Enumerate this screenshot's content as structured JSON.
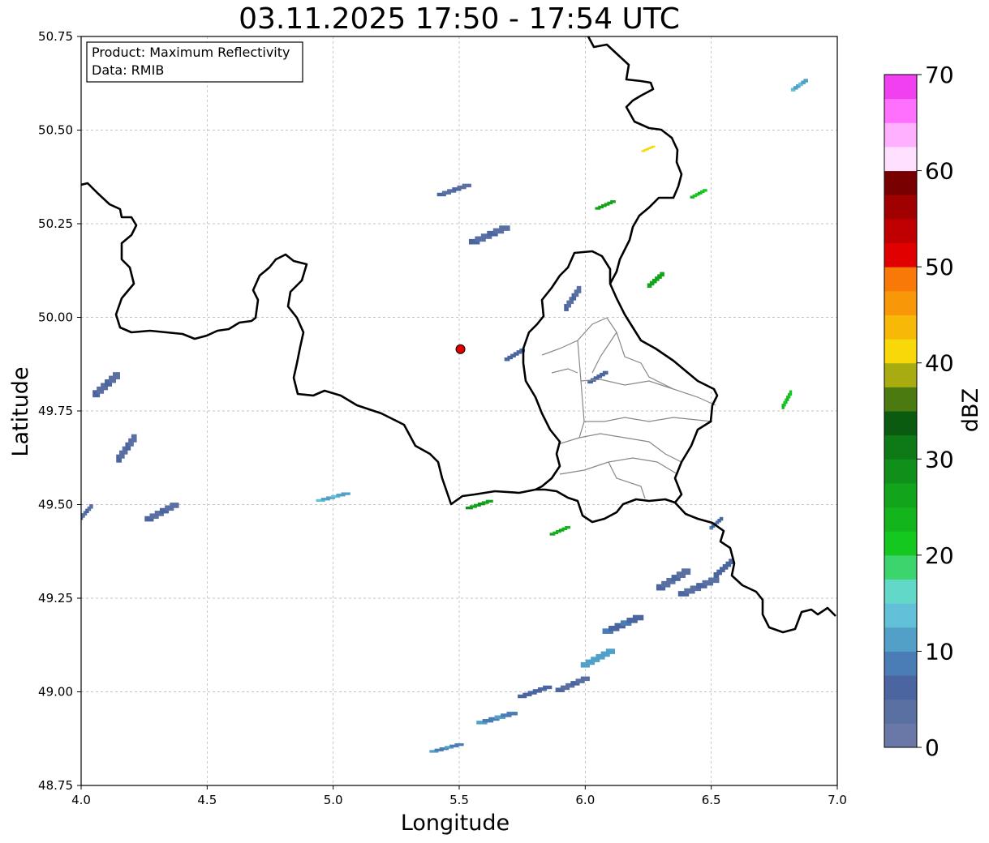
{
  "title": "03.11.2025 17:50 - 17:54 UTC",
  "axes": {
    "xlabel": "Longitude",
    "ylabel": "Latitude",
    "x_range": [
      4.0,
      7.0
    ],
    "y_range": [
      48.75,
      50.75
    ],
    "x_ticks": [
      "4.0",
      "4.5",
      "5.0",
      "5.5",
      "6.0",
      "6.5",
      "7.0"
    ],
    "y_ticks": [
      "48.75",
      "49.00",
      "49.25",
      "49.50",
      "49.75",
      "50.00",
      "50.25",
      "50.50",
      "50.75"
    ],
    "grid": true
  },
  "info_box": {
    "line1": "Product: Maximum Reflectivity",
    "line2": "Data: RMIB"
  },
  "colorbar": {
    "label": "dBZ",
    "min": 0,
    "max": 70,
    "ticks": [
      "0",
      "10",
      "20",
      "30",
      "40",
      "50",
      "60",
      "70"
    ],
    "colors": [
      "#6a78a8",
      "#5a6fa2",
      "#4a65a0",
      "#4a7db5",
      "#52a0c8",
      "#62c0d8",
      "#62d8c8",
      "#3cd46c",
      "#14c820",
      "#14b41c",
      "#12a41a",
      "#10901a",
      "#0e7a16",
      "#0a5a10",
      "#4a7a10",
      "#a8ac10",
      "#f8d808",
      "#f8b808",
      "#f89808",
      "#f87808",
      "#e00000",
      "#c00000",
      "#a00000",
      "#780000",
      "#ffe0ff",
      "#ffb0ff",
      "#ff70ff",
      "#f040f0"
    ]
  },
  "radar_site": {
    "lon": 5.505,
    "lat": 49.915,
    "color": "#e00000"
  },
  "chart_data": {
    "type": "map",
    "product": "Maximum Reflectivity",
    "source": "RMIB",
    "time_start": "03.11.2025 17:50",
    "time_end": "17:54 UTC",
    "extent": {
      "lon": [
        4.0,
        7.0
      ],
      "lat": [
        48.75,
        50.75
      ]
    },
    "echoes": [
      {
        "lon": 6.35,
        "lat": 49.3,
        "w": 0.1,
        "h": 0.07,
        "dbz": 3
      },
      {
        "lon": 6.45,
        "lat": 49.28,
        "w": 0.12,
        "h": 0.06,
        "dbz": 4
      },
      {
        "lon": 6.55,
        "lat": 49.33,
        "w": 0.06,
        "h": 0.06,
        "dbz": 5
      },
      {
        "lon": 6.15,
        "lat": 49.18,
        "w": 0.12,
        "h": 0.06,
        "dbz": 6
      },
      {
        "lon": 6.05,
        "lat": 49.09,
        "w": 0.1,
        "h": 0.06,
        "dbz": 10
      },
      {
        "lon": 5.95,
        "lat": 49.02,
        "w": 0.1,
        "h": 0.05,
        "dbz": 4
      },
      {
        "lon": 5.8,
        "lat": 49.0,
        "w": 0.1,
        "h": 0.04,
        "dbz": 5
      },
      {
        "lon": 5.65,
        "lat": 48.93,
        "w": 0.12,
        "h": 0.04,
        "dbz": 9
      },
      {
        "lon": 5.45,
        "lat": 48.85,
        "w": 0.1,
        "h": 0.03,
        "dbz": 8
      },
      {
        "lon": 4.1,
        "lat": 49.82,
        "w": 0.08,
        "h": 0.08,
        "dbz": 3
      },
      {
        "lon": 4.18,
        "lat": 49.65,
        "w": 0.06,
        "h": 0.09,
        "dbz": 3
      },
      {
        "lon": 4.32,
        "lat": 49.48,
        "w": 0.1,
        "h": 0.06,
        "dbz": 3
      },
      {
        "lon": 4.02,
        "lat": 49.48,
        "w": 0.04,
        "h": 0.05,
        "dbz": 3
      },
      {
        "lon": 5.62,
        "lat": 50.22,
        "w": 0.12,
        "h": 0.06,
        "dbz": 4
      },
      {
        "lon": 5.72,
        "lat": 49.9,
        "w": 0.06,
        "h": 0.04,
        "dbz": 5
      },
      {
        "lon": 5.95,
        "lat": 50.05,
        "w": 0.05,
        "h": 0.08,
        "dbz": 3
      },
      {
        "lon": 6.08,
        "lat": 50.3,
        "w": 0.06,
        "h": 0.03,
        "dbz": 25
      },
      {
        "lon": 6.45,
        "lat": 50.33,
        "w": 0.05,
        "h": 0.03,
        "dbz": 22
      },
      {
        "lon": 6.28,
        "lat": 50.1,
        "w": 0.05,
        "h": 0.05,
        "dbz": 25
      },
      {
        "lon": 6.25,
        "lat": 50.45,
        "w": 0.04,
        "h": 0.02,
        "dbz": 40
      },
      {
        "lon": 5.48,
        "lat": 50.34,
        "w": 0.1,
        "h": 0.04,
        "dbz": 4
      },
      {
        "lon": 5.0,
        "lat": 49.52,
        "w": 0.1,
        "h": 0.03,
        "dbz": 12
      },
      {
        "lon": 5.58,
        "lat": 49.5,
        "w": 0.08,
        "h": 0.03,
        "dbz": 26
      },
      {
        "lon": 5.9,
        "lat": 49.43,
        "w": 0.06,
        "h": 0.03,
        "dbz": 24
      },
      {
        "lon": 6.85,
        "lat": 50.62,
        "w": 0.05,
        "h": 0.04,
        "dbz": 12
      },
      {
        "lon": 6.52,
        "lat": 49.45,
        "w": 0.04,
        "h": 0.04,
        "dbz": 6
      },
      {
        "lon": 6.05,
        "lat": 49.84,
        "w": 0.06,
        "h": 0.04,
        "dbz": 5
      },
      {
        "lon": 6.8,
        "lat": 49.78,
        "w": 0.03,
        "h": 0.06,
        "dbz": 22
      }
    ]
  }
}
